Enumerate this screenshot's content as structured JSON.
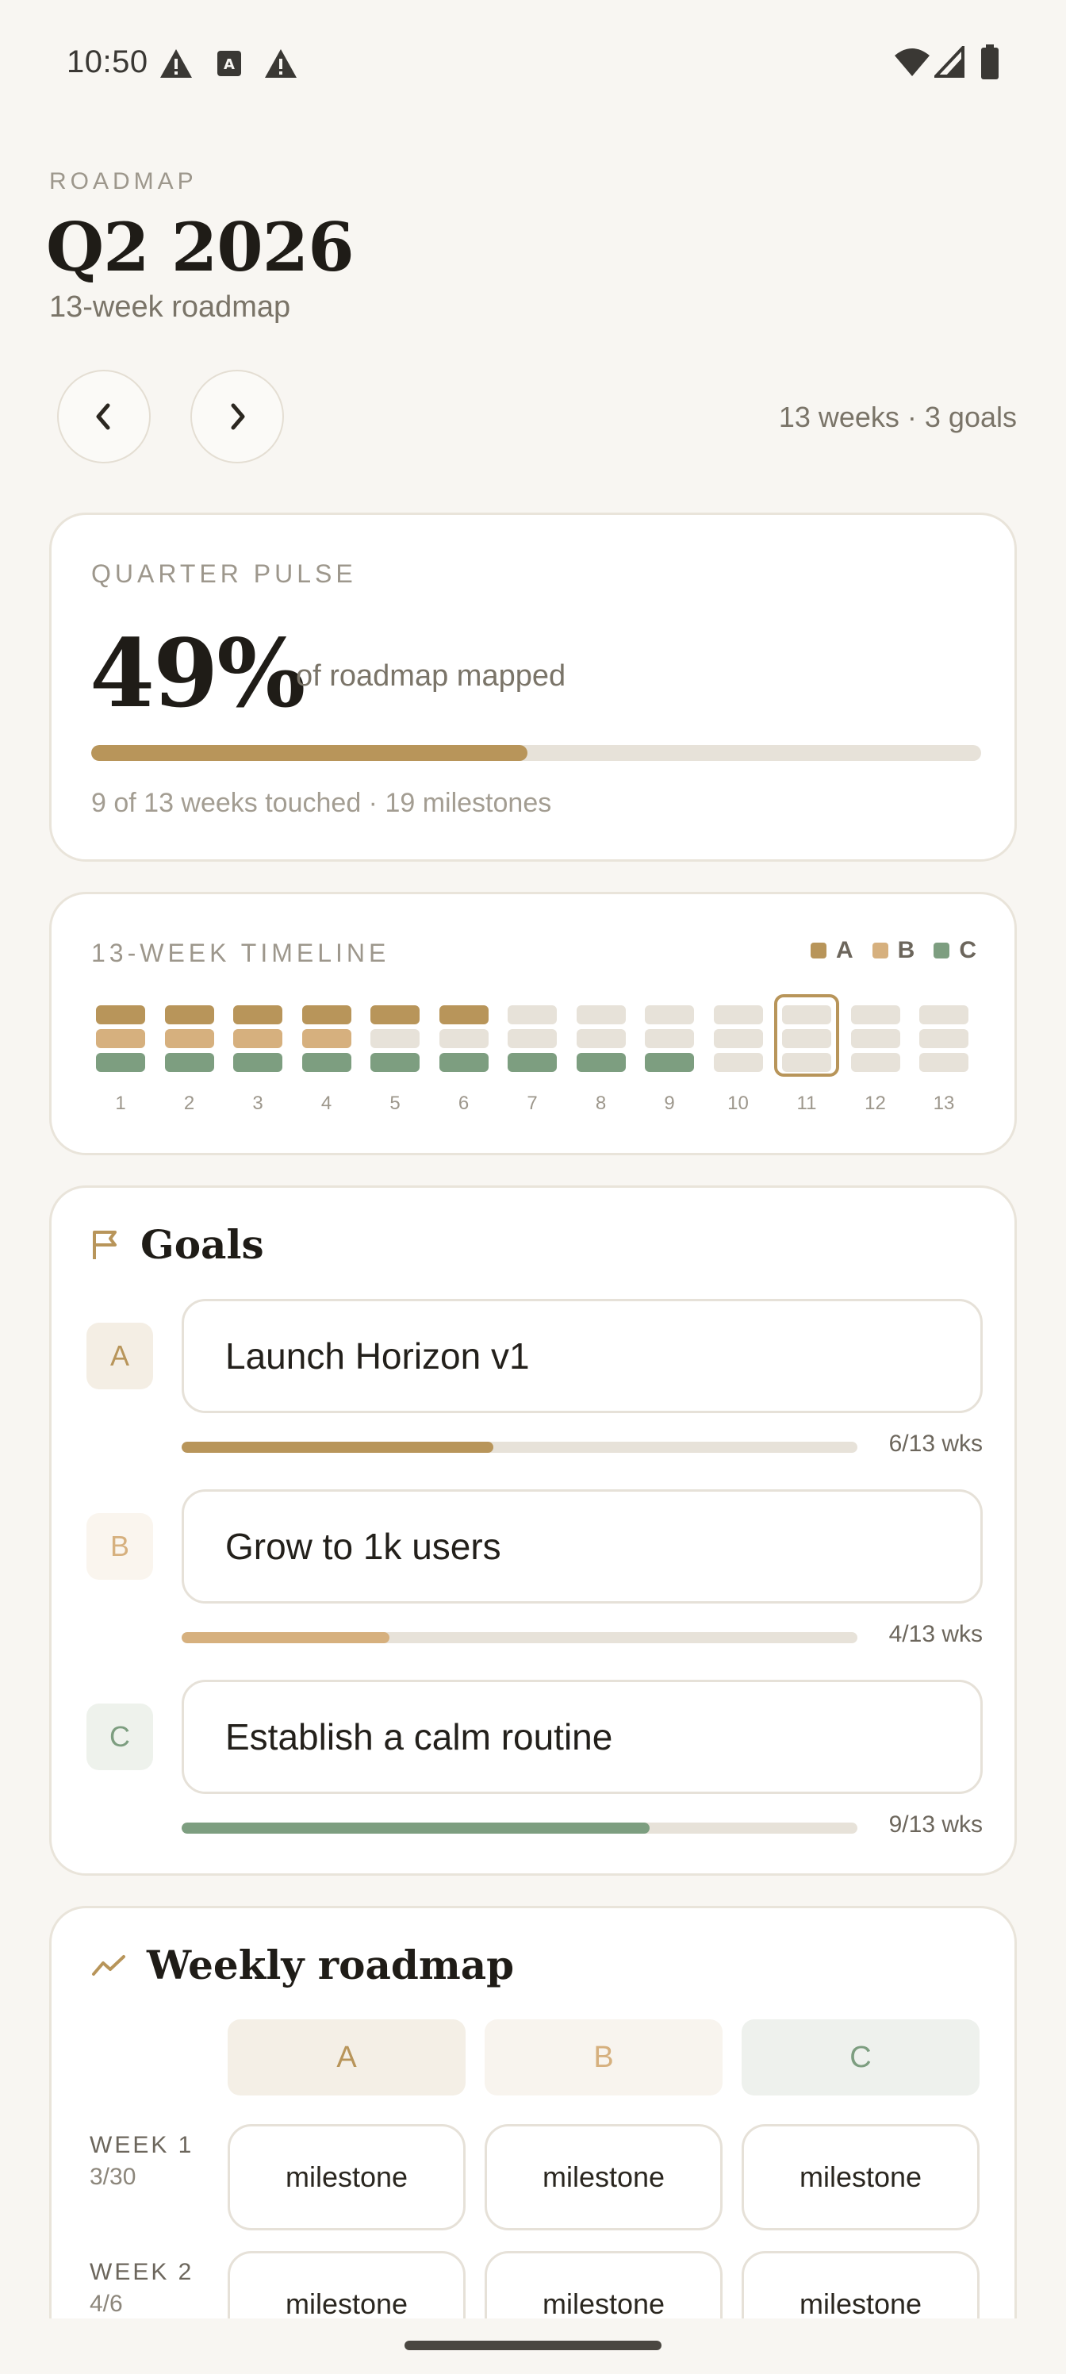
{
  "status_bar": {
    "time": "10:50"
  },
  "header": {
    "eyebrow": "ROADMAP",
    "title": "Q2 2026",
    "subtitle": "13-week roadmap",
    "meta": "13 weeks · 3 goals"
  },
  "pulse": {
    "label": "QUARTER PULSE",
    "value": "49%",
    "caption": "of roadmap mapped",
    "progress_fraction": 0.49,
    "footnote": "9 of 13 weeks touched · 19 milestones"
  },
  "timeline": {
    "label": "13-WEEK TIMELINE",
    "legend": [
      "A",
      "B",
      "C"
    ],
    "colors": {
      "A": "#b8955a",
      "B": "#d6b07e",
      "C": "#7d9e80",
      "empty": "#e7e2d9"
    },
    "current_week": 11,
    "weeks": [
      {
        "n": "1",
        "a": true,
        "b": true,
        "c": true
      },
      {
        "n": "2",
        "a": true,
        "b": true,
        "c": true
      },
      {
        "n": "3",
        "a": true,
        "b": true,
        "c": true
      },
      {
        "n": "4",
        "a": true,
        "b": true,
        "c": true
      },
      {
        "n": "5",
        "a": true,
        "b": false,
        "c": true
      },
      {
        "n": "6",
        "a": true,
        "b": false,
        "c": true
      },
      {
        "n": "7",
        "a": false,
        "b": false,
        "c": true
      },
      {
        "n": "8",
        "a": false,
        "b": false,
        "c": true
      },
      {
        "n": "9",
        "a": false,
        "b": false,
        "c": true
      },
      {
        "n": "10",
        "a": false,
        "b": false,
        "c": false
      },
      {
        "n": "11",
        "a": false,
        "b": false,
        "c": false
      },
      {
        "n": "12",
        "a": false,
        "b": false,
        "c": false
      },
      {
        "n": "13",
        "a": false,
        "b": false,
        "c": false
      }
    ]
  },
  "goals": {
    "title": "Goals",
    "items": [
      {
        "key": "A",
        "text": "Launch Horizon v1",
        "progress": "6/13 wks",
        "fraction": 0.4615,
        "color": "#b8955a",
        "badge_bg": "#f4eee4",
        "badge_fg": "#b8955a"
      },
      {
        "key": "B",
        "text": "Grow to 1k users",
        "progress": "4/13 wks",
        "fraction": 0.3077,
        "color": "#d6b07e",
        "badge_bg": "#faf5ee",
        "badge_fg": "#d6b07e"
      },
      {
        "key": "C",
        "text": "Establish a calm routine",
        "progress": "9/13 wks",
        "fraction": 0.6923,
        "color": "#7d9e80",
        "badge_bg": "#eef2ec",
        "badge_fg": "#7d9e80"
      }
    ]
  },
  "weekly": {
    "title": "Weekly roadmap",
    "columns": [
      {
        "key": "A",
        "bg": "#f4efe6",
        "fg": "#b8955a"
      },
      {
        "key": "B",
        "bg": "#f8f4ee",
        "fg": "#d6b07e"
      },
      {
        "key": "C",
        "bg": "#eef1ed",
        "fg": "#7d9e80"
      }
    ],
    "rows": [
      {
        "label": "WEEK 1",
        "date": "3/30",
        "cells": [
          "milestone",
          "milestone",
          "milestone"
        ]
      },
      {
        "label": "WEEK 2",
        "date": "4/6",
        "cells": [
          "milestone",
          "milestone",
          "milestone"
        ]
      }
    ]
  }
}
